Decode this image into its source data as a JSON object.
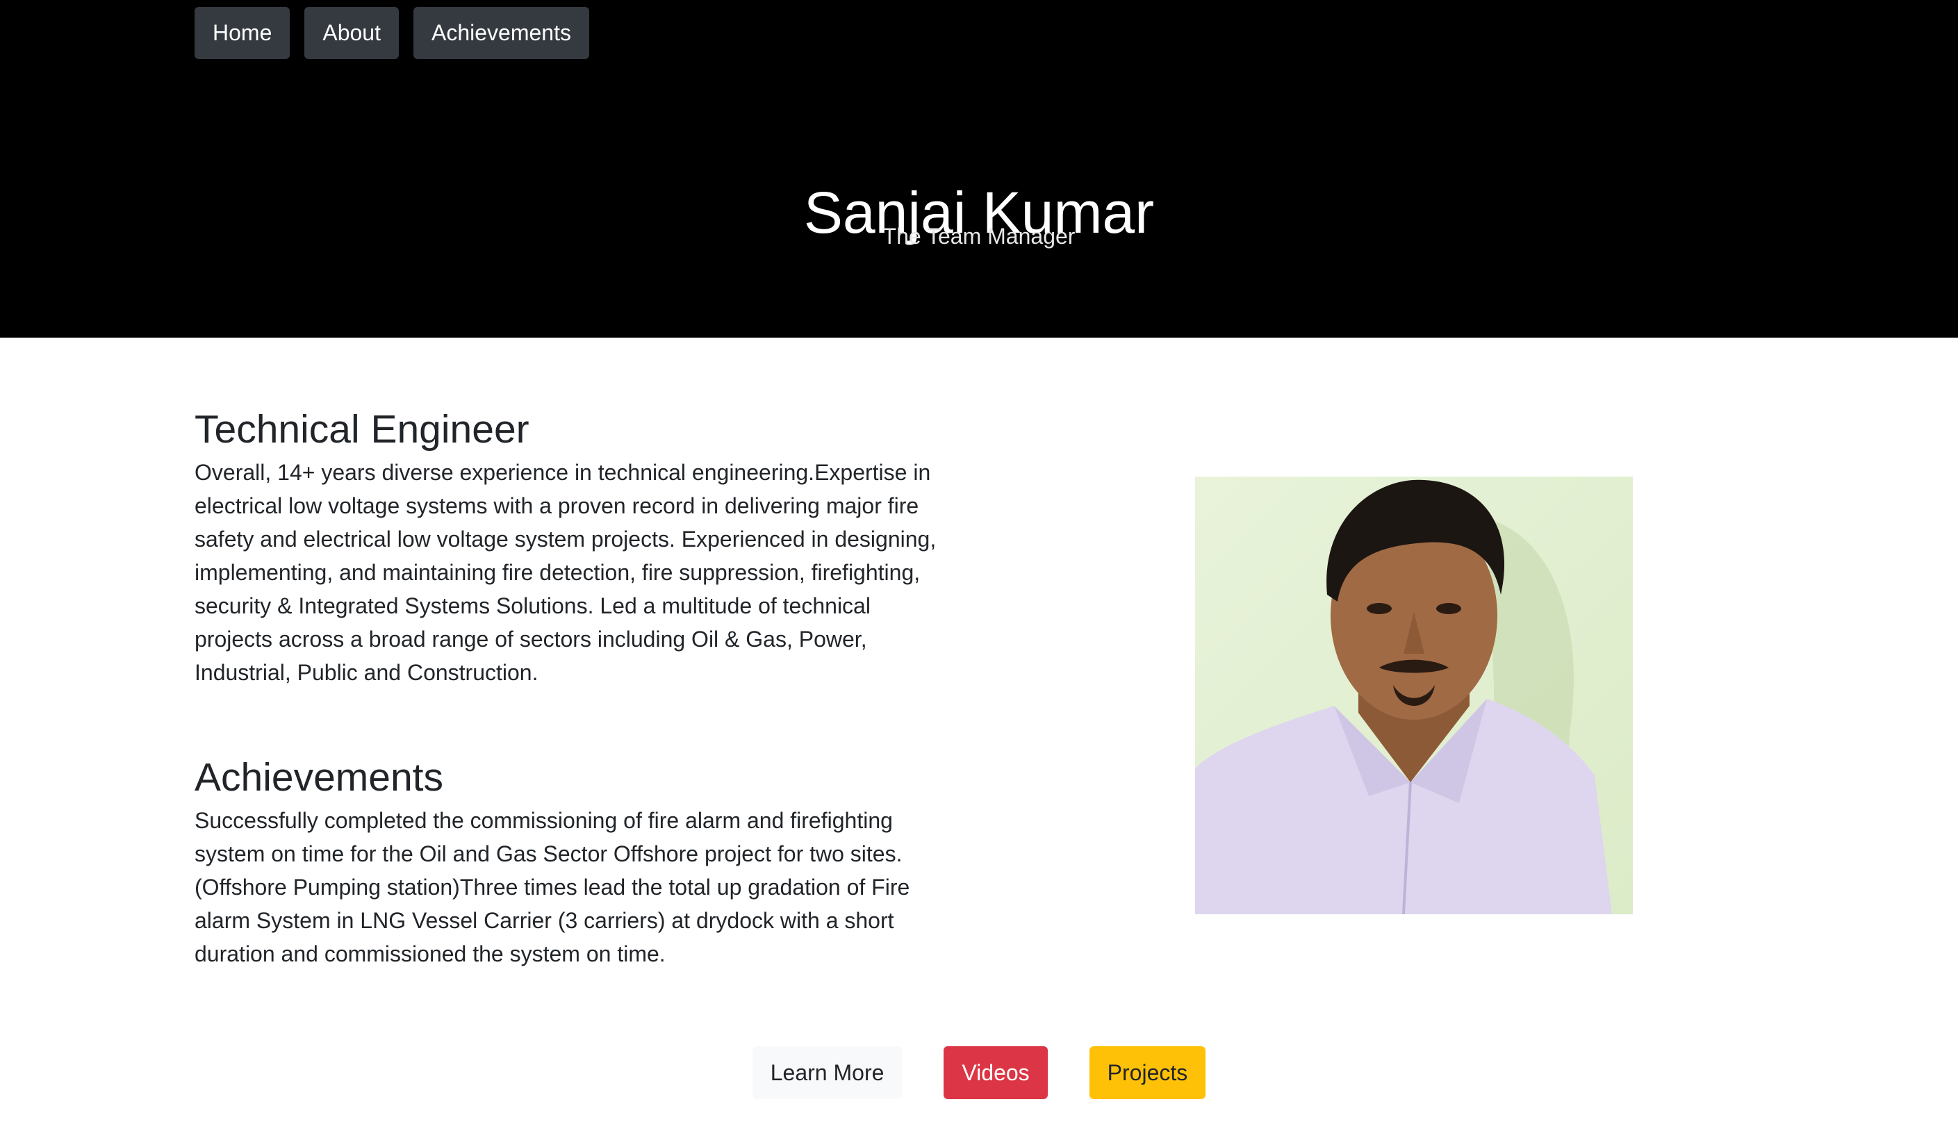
{
  "nav": {
    "items": [
      {
        "label": "Home"
      },
      {
        "label": "About"
      },
      {
        "label": "Achievements"
      }
    ]
  },
  "hero": {
    "title": "Sanjai Kumar",
    "subtitle": "The Team Manager"
  },
  "about": {
    "heading": "Technical Engineer",
    "text": "Overall, 14+ years diverse experience in technical engineering.Expertise in electrical low voltage systems with a proven record in delivering major fire safety and electrical low voltage system projects. Experienced in designing, implementing, and maintaining fire detection, fire suppression, firefighting, security & Integrated Systems Solutions. Led a multitude of technical projects across a broad range of sectors including Oil & Gas, Power, Industrial, Public and Construction."
  },
  "achievements": {
    "heading": "Achievements",
    "text": "Successfully completed the commissioning of fire alarm and firefighting system on time for the Oil and Gas Sector Offshore project for two sites.(Offshore Pumping station)Three times lead the total up gradation of Fire alarm System in LNG Vessel Carrier (3 carriers) at drydock with a short duration and commissioned the system on time."
  },
  "actions": {
    "learn_more": "Learn More",
    "videos": "Videos",
    "projects": "Projects"
  },
  "colors": {
    "header_bg": "#000000",
    "nav_button_bg": "#343a40",
    "danger": "#dc3545",
    "warning": "#ffc107",
    "light": "#f8f9fa"
  }
}
